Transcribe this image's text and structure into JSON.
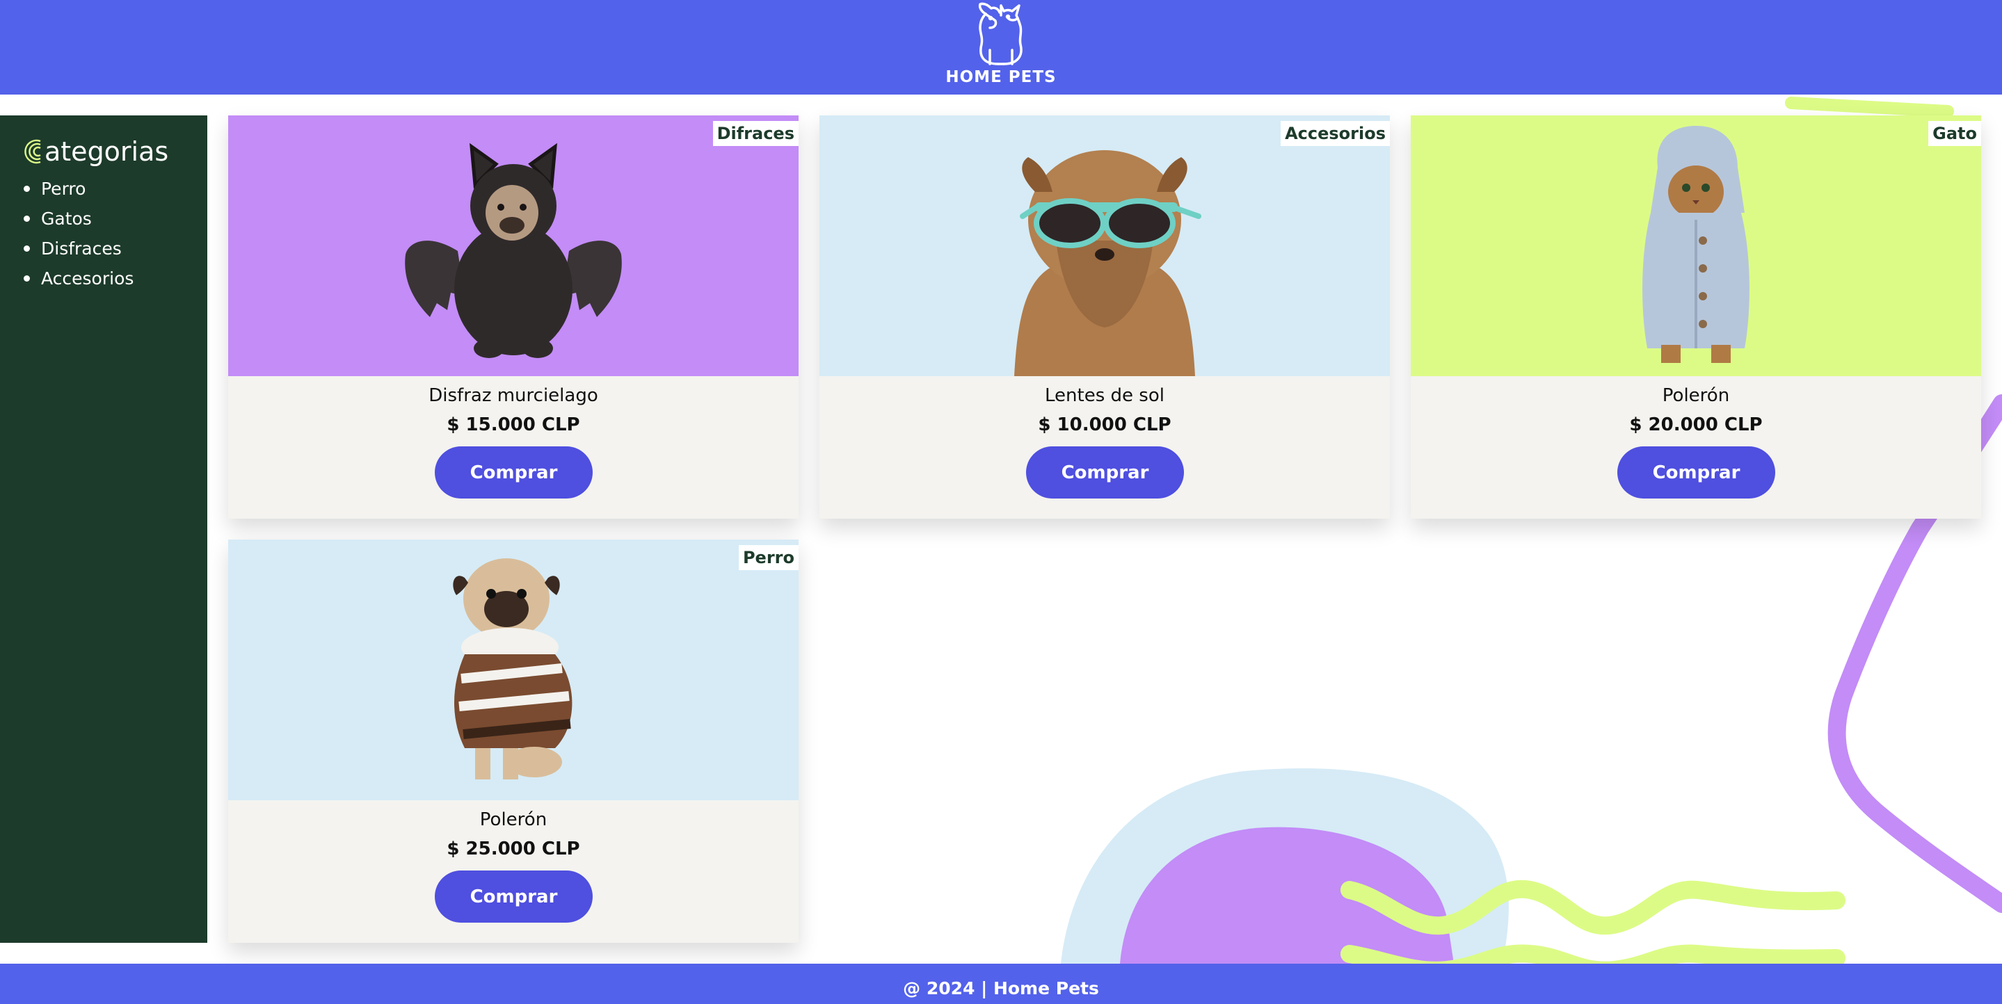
{
  "header": {
    "brand": "HOME PETS",
    "logo_icon": "dog-cat-logo-icon"
  },
  "sidebar": {
    "title_rest": "ategorias",
    "items": [
      {
        "label": "Perro"
      },
      {
        "label": "Gatos"
      },
      {
        "label": "Disfraces"
      },
      {
        "label": "Accesorios"
      }
    ]
  },
  "products": [
    {
      "tag": "Difraces",
      "name": "Disfraz murcielago",
      "price": "$ 15.000 CLP",
      "button": "Comprar",
      "image_bg": "#c38cf7",
      "image": "bat-costume-pug-image"
    },
    {
      "tag": "Accesorios",
      "name": "Lentes de sol",
      "price": "$ 10.000 CLP",
      "button": "Comprar",
      "image_bg": "#d6ebf6",
      "image": "dog-sunglasses-image"
    },
    {
      "tag": "Gato",
      "name": "Polerón",
      "price": "$ 20.000 CLP",
      "button": "Comprar",
      "image_bg": "#dcfb86",
      "image": "cat-hoodie-image"
    },
    {
      "tag": "Perro",
      "name": "Polerón",
      "price": "$ 25.000 CLP",
      "button": "Comprar",
      "image_bg": "#d6ebf6",
      "image": "pug-sweater-image"
    }
  ],
  "footer": {
    "text": "@ 2024 | Home Pets"
  },
  "colors": {
    "header_bg": "#5362ea",
    "sidebar_bg": "#1d3b2b",
    "card_bg": "#f4f3ef",
    "button_bg": "#4f4fe0",
    "accent_purple": "#c38cf7",
    "accent_lime": "#dcfb86",
    "accent_lightblue": "#d6ebf6"
  }
}
